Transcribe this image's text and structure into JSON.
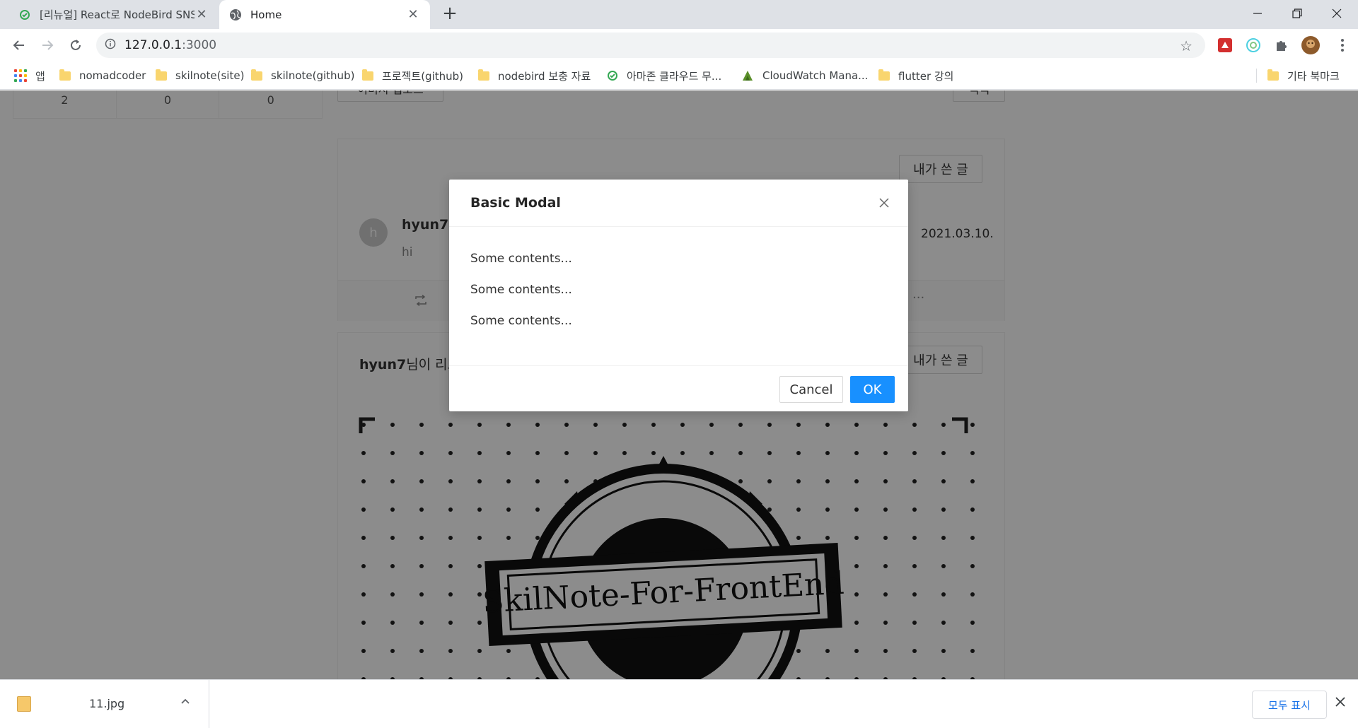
{
  "browser": {
    "tabs": [
      {
        "title": "[리뉴얼] React로 NodeBird SNS 만들기",
        "active": false
      },
      {
        "title": "Home",
        "active": true
      }
    ],
    "new_tab_symbol": "+",
    "address": {
      "host": "127.0.0.1",
      "port": ":3000"
    },
    "bookmarks": [
      {
        "label": "앱",
        "icon": "apps-icon"
      },
      {
        "label": "nomadcoder",
        "icon": "folder-icon"
      },
      {
        "label": "skilnote(site)",
        "icon": "folder-icon"
      },
      {
        "label": "skilnote(github)",
        "icon": "folder-icon"
      },
      {
        "label": "프로젝트(github)",
        "icon": "folder-icon"
      },
      {
        "label": "nodebird 보충 자료",
        "icon": "folder-icon"
      },
      {
        "label": "아마존 클라우드 무...",
        "icon": "site-icon"
      },
      {
        "label": "CloudWatch Mana...",
        "icon": "cloudwatch-icon"
      },
      {
        "label": "flutter 강의",
        "icon": "folder-icon"
      }
    ],
    "other_bookmarks": "기타 북마크"
  },
  "page": {
    "user_stats": [
      "2",
      "0",
      "0"
    ],
    "top_buttons": {
      "left": "이미지 업로드",
      "right": "짹짹"
    },
    "my_posts_button": "내가 쓴 글",
    "post": {
      "avatar_initial": "h",
      "author": "hyun7",
      "content": "hi",
      "date": "2021.03.10.",
      "more": "···"
    },
    "retweet_heading": {
      "user": "hyun7",
      "suffix": "님이 리트윗하셨습니다."
    },
    "image_caption": "SkilNote-For-FrontEnd"
  },
  "modal": {
    "title": "Basic Modal",
    "contents": [
      "Some contents...",
      "Some contents...",
      "Some contents..."
    ],
    "cancel_label": "Cancel",
    "ok_label": "OK"
  },
  "download_bar": {
    "file_name": "11.jpg",
    "show_all_label": "모두 표시"
  },
  "colors": {
    "primary": "#1890ff",
    "mask": "rgba(0,0,0,0.45)"
  }
}
